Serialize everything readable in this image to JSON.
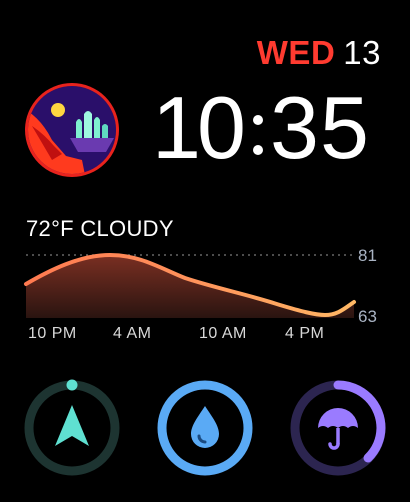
{
  "date": {
    "weekday": "WED",
    "day": "13"
  },
  "time": {
    "h1": "1",
    "h2": "0",
    "m1": "3",
    "m2": "5"
  },
  "weather": {
    "summary": "72°F CLOUDY",
    "high_label": "81",
    "low_label": "63",
    "hours": [
      "10 PM",
      "4 AM",
      "10 AM",
      "4 PM"
    ]
  },
  "complications": {
    "navigation": {
      "icon": "navigation-arrow-icon",
      "color": "#5fe0d1"
    },
    "water": {
      "icon": "water-drop-icon",
      "color": "#5aaaf5"
    },
    "rain_chance": {
      "icon": "umbrella-icon",
      "color": "#9a7bff"
    }
  },
  "colors": {
    "weekday": "#ff3b30",
    "graph_warm": "#ff8a55",
    "graph_cool": "#ffb060"
  }
}
